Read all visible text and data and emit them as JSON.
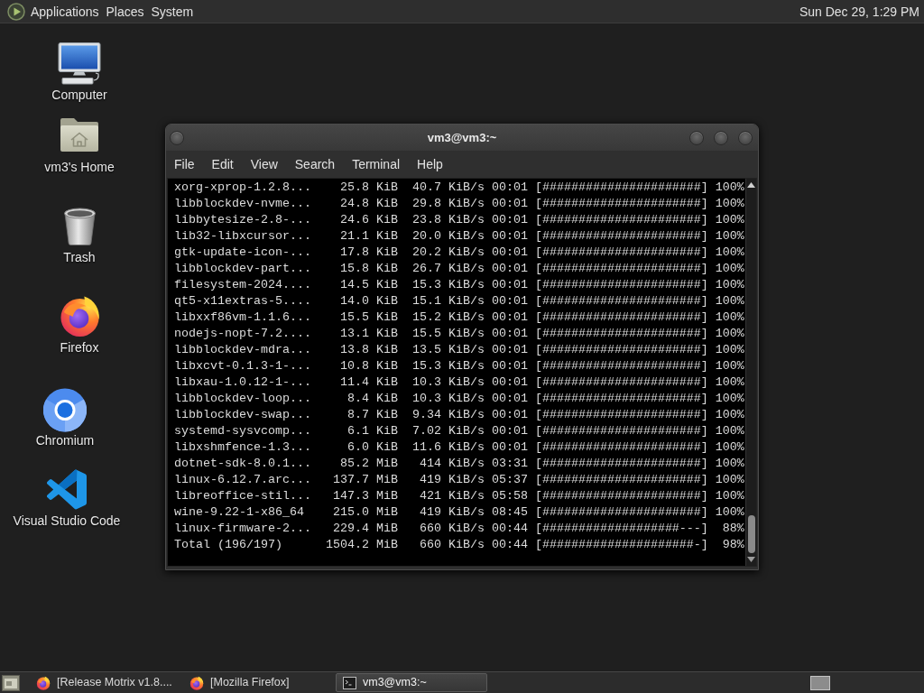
{
  "top_panel": {
    "menus": [
      "Applications",
      "Places",
      "System"
    ],
    "clock": "Sun Dec 29, 1:29 PM"
  },
  "desktop_icons": [
    {
      "label": "Computer",
      "kind": "computer"
    },
    {
      "label": "vm3's Home",
      "kind": "home-folder"
    },
    {
      "label": "Trash",
      "kind": "trash"
    },
    {
      "label": "Firefox",
      "kind": "firefox"
    },
    {
      "label": "Chromium",
      "kind": "chromium"
    },
    {
      "label": "Visual Studio Code",
      "kind": "vscode"
    }
  ],
  "terminal": {
    "title": "vm3@vm3:~",
    "menu": [
      "File",
      "Edit",
      "View",
      "Search",
      "Terminal",
      "Help"
    ],
    "lines": [
      "xorg-xprop-1.2.8...    25.8 KiB  40.7 KiB/s 00:01 [######################] 100%",
      "libblockdev-nvme...    24.8 KiB  29.8 KiB/s 00:01 [######################] 100%",
      "libbytesize-2.8-...    24.6 KiB  23.8 KiB/s 00:01 [######################] 100%",
      "lib32-libxcursor...    21.1 KiB  20.0 KiB/s 00:01 [######################] 100%",
      "gtk-update-icon-...    17.8 KiB  20.2 KiB/s 00:01 [######################] 100%",
      "libblockdev-part...    15.8 KiB  26.7 KiB/s 00:01 [######################] 100%",
      "filesystem-2024....    14.5 KiB  15.3 KiB/s 00:01 [######################] 100%",
      "qt5-x11extras-5....    14.0 KiB  15.1 KiB/s 00:01 [######################] 100%",
      "libxxf86vm-1.1.6...    15.5 KiB  15.2 KiB/s 00:01 [######################] 100%",
      "nodejs-nopt-7.2....    13.1 KiB  15.5 KiB/s 00:01 [######################] 100%",
      "libblockdev-mdra...    13.8 KiB  13.5 KiB/s 00:01 [######################] 100%",
      "libxcvt-0.1.3-1-...    10.8 KiB  15.3 KiB/s 00:01 [######################] 100%",
      "libxau-1.0.12-1-...    11.4 KiB  10.3 KiB/s 00:01 [######################] 100%",
      "libblockdev-loop...     8.4 KiB  10.3 KiB/s 00:01 [######################] 100%",
      "libblockdev-swap...     8.7 KiB  9.34 KiB/s 00:01 [######################] 100%",
      "systemd-sysvcomp...     6.1 KiB  7.02 KiB/s 00:01 [######################] 100%",
      "libxshmfence-1.3...     6.0 KiB  11.6 KiB/s 00:01 [######################] 100%",
      "dotnet-sdk-8.0.1...    85.2 MiB   414 KiB/s 03:31 [######################] 100%",
      "linux-6.12.7.arc...   137.7 MiB   419 KiB/s 05:37 [######################] 100%",
      "libreoffice-stil...   147.3 MiB   421 KiB/s 05:58 [######################] 100%",
      "wine-9.22-1-x86_64    215.0 MiB   419 KiB/s 08:45 [######################] 100%",
      "linux-firmware-2...   229.4 MiB   660 KiB/s 00:44 [###################---]  88%",
      "Total (196/197)      1504.2 MiB   660 KiB/s 00:44 [#####################-]  98%"
    ]
  },
  "taskbar": {
    "tasks": [
      {
        "label": "[Release Motrix v1.8....",
        "kind": "browser",
        "selected": false
      },
      {
        "label": "[Mozilla Firefox]",
        "kind": "browser",
        "selected": false
      },
      {
        "label": "vm3@vm3:~",
        "kind": "terminal",
        "selected": true
      }
    ]
  }
}
